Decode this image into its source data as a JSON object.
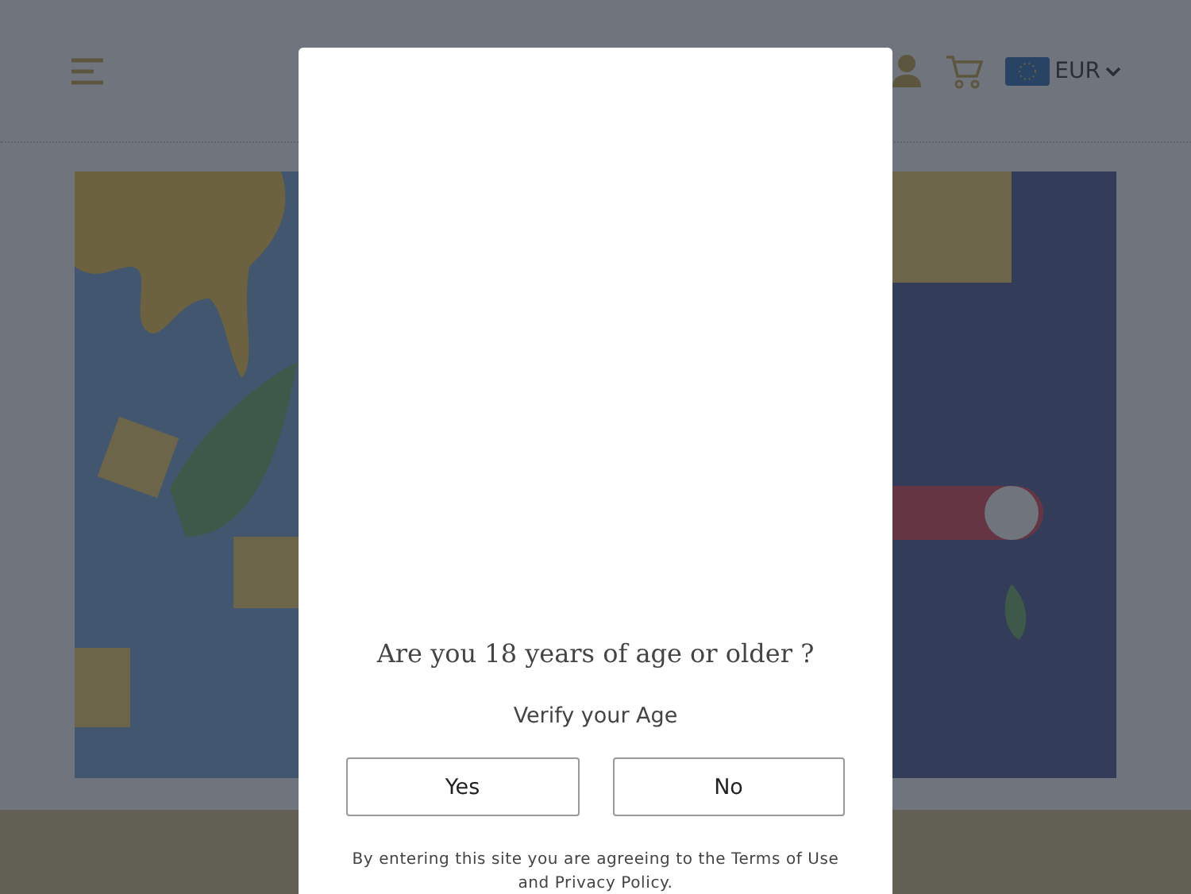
{
  "header": {
    "currency": "EUR"
  },
  "age_gate": {
    "question": "Are you 18 years of age or older ?",
    "subtitle": "Verify your Age",
    "buttons": [
      {
        "label": "Yes"
      },
      {
        "label": "No"
      }
    ],
    "disclaimer": "By entering this site you are agreeing to the Terms of Use and Privacy Policy."
  }
}
